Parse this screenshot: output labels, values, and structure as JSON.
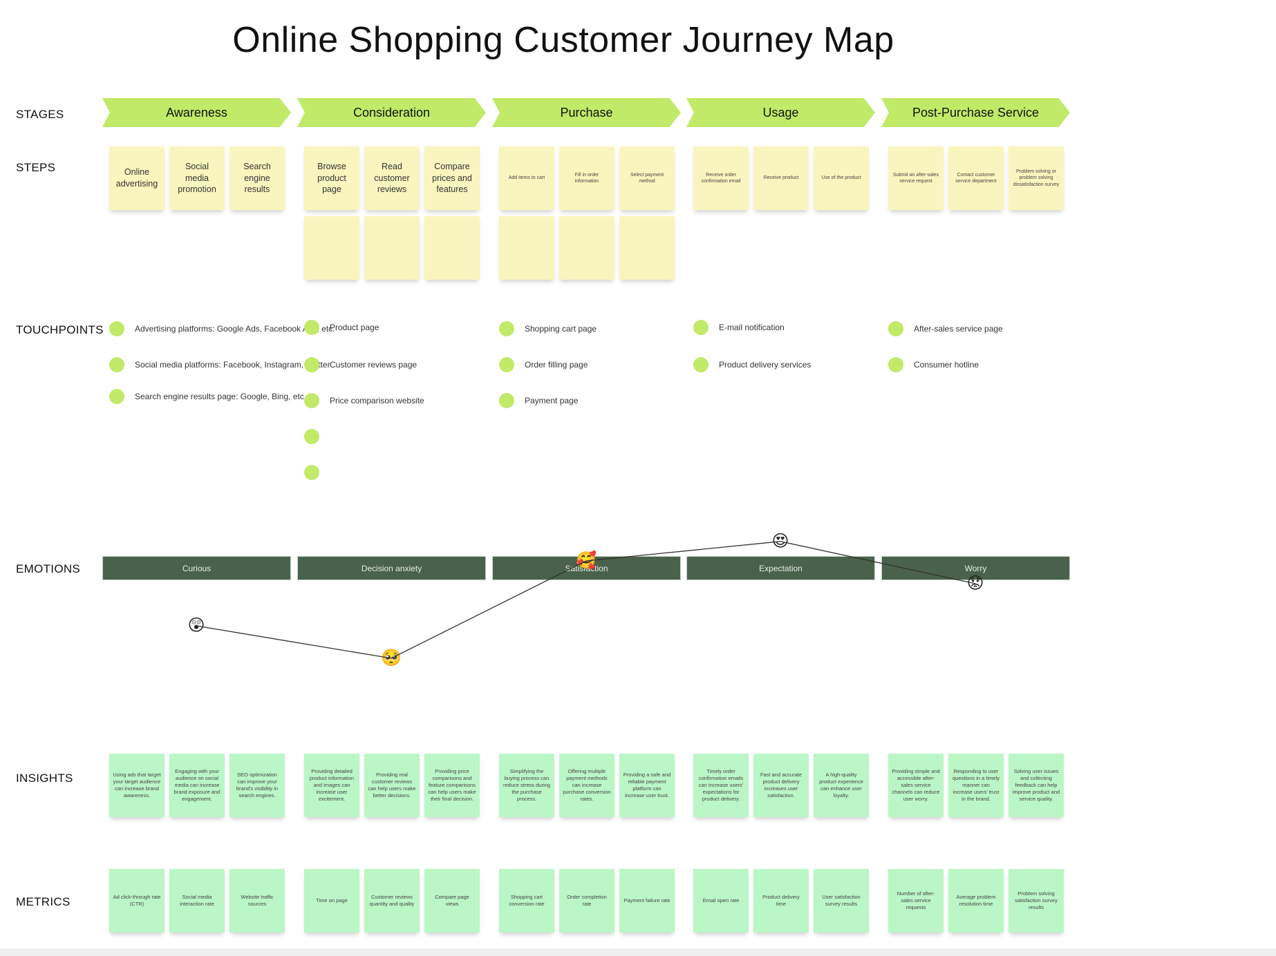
{
  "title": "Online Shopping Customer Journey Map",
  "row_labels": {
    "stages": "STAGES",
    "steps": "STEPS",
    "touchpoints": "TOUCHPOINTS",
    "emotions": "EMOTIONS",
    "insights": "INSIGHTS",
    "metrics": "METRICS"
  },
  "colors": {
    "stage": "#c1ea68",
    "step_card": "#f9f5be",
    "insight_card": "#bbf6c6",
    "emotion_bar": "#4a614b",
    "touchpoint_dot": "#c1ea68"
  },
  "stages": [
    {
      "name": "Awareness",
      "steps": [
        "Online advertising",
        "Social media promotion",
        "Search engine results"
      ],
      "extra_blank_steps": 0,
      "touchpoints": [
        "Advertising platforms: Google Ads, Facebook Ads, etc.",
        "Social media platforms: Facebook, Instagram, Twitter",
        "Search engine results page: Google, Bing, etc."
      ],
      "emotion": "Curious",
      "emoji": "😲",
      "emoji_name": "astonished-face-icon",
      "emotion_level": 2,
      "insights": [
        "Using ads that target your target audience can increase brand awareness.",
        "Engaging with your audience on social media can increase brand exposure and engagement.",
        "SEO optimization can improve your brand's visibility in search engines."
      ],
      "metrics": [
        "Ad click-through rate (CTR)",
        "Social media interaction rate",
        "Website traffic sources"
      ]
    },
    {
      "name": "Consideration",
      "steps": [
        "Browse product page",
        "Read customer reviews",
        "Compare prices and features"
      ],
      "extra_blank_steps": 3,
      "touchpoints": [
        "Product page",
        "Customer reviews page",
        "Price comparison website",
        "",
        ""
      ],
      "emotion": "Decision anxiety",
      "emoji": "🥺",
      "emoji_name": "pleading-face-icon",
      "emotion_level": 1,
      "insights": [
        "Providing detailed product information and images can increase user excitement.",
        "Providing real customer reviews can help users make better decisions.",
        "Providing price comparisons and feature comparisons can help users make their final decision."
      ],
      "metrics": [
        "Time on page",
        "Customer reviews quantity and quality",
        "Compare page views"
      ]
    },
    {
      "name": "Purchase",
      "steps": [
        "Add items to cart",
        "Fill in order information",
        "Select payment method"
      ],
      "extra_blank_steps": 3,
      "touchpoints": [
        "Shopping cart page",
        "Order filling page",
        "Payment page"
      ],
      "emotion": "Satisfaction",
      "emoji": "🥰",
      "emoji_name": "smiling-face-with-hearts-icon",
      "emotion_level": 4,
      "insights": [
        "Simplifying the buying process can reduce stress during the purchase process.",
        "Offering multiple payment methods can increase purchase conversion rates.",
        "Providing a safe and reliable payment platform can increase user trust."
      ],
      "metrics": [
        "Shopping cart conversion rate",
        "Order completion rate",
        "Payment failure rate"
      ]
    },
    {
      "name": "Usage",
      "steps": [
        "Receive order confirmation email",
        "Receive product",
        "Use of the product"
      ],
      "extra_blank_steps": 0,
      "touchpoints": [
        "E-mail notification",
        "Product delivery services"
      ],
      "emotion": "Expectation",
      "emoji": "😍",
      "emoji_name": "heart-eyes-face-icon",
      "emotion_level": 4.6,
      "insights": [
        "Timely order confirmation emails can increase users' expectations for product delivery.",
        "Fast and accurate product delivery increases user satisfaction.",
        "A high-quality product experience can enhance user loyalty."
      ],
      "metrics": [
        "Email open rate",
        "Product delivery time",
        "User satisfaction survey results"
      ]
    },
    {
      "name": "Post-Purchase Service",
      "steps": [
        "Submit an after-sales service request",
        "Contact customer service department",
        "Problem solving or problem solving dissatisfaction survey"
      ],
      "extra_blank_steps": 0,
      "touchpoints": [
        "After-sales service page",
        "Consumer hotline"
      ],
      "emotion": "Worry",
      "emoji": "😟",
      "emoji_name": "worried-face-icon",
      "emotion_level": 3.3,
      "insights": [
        "Providing simple and accessible after-sales service channels can reduce user worry.",
        "Responding to user questions in a timely manner can increase users' trust in the brand.",
        "Solving user issues and collecting feedback can help improve product and service quality."
      ],
      "metrics": [
        "Number of after-sales service requests",
        "Average problem resolution time",
        "Problem solving satisfaction survey results"
      ]
    }
  ]
}
